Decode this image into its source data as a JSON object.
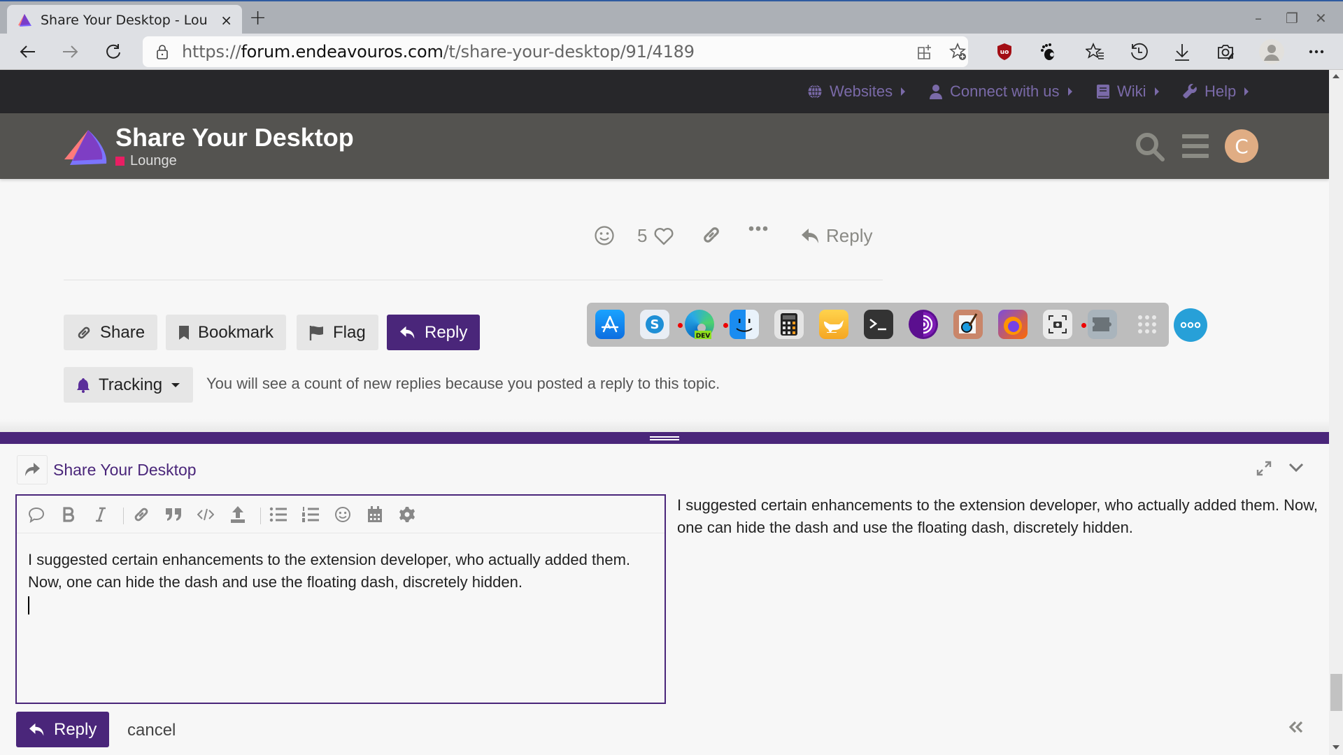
{
  "browser": {
    "tab_title": "Share Your Desktop - Lounge",
    "tab_close": "×",
    "new_tab": "+",
    "url_scheme": "https://",
    "url_host": "forum.endeavouros.com",
    "url_path": "/t/share-your-desktop/91/4189",
    "window_controls": {
      "minimize": "–",
      "restore": "❐",
      "close": "✕"
    },
    "toolbar_icons": [
      "split-screen-icon",
      "add-favorite-icon",
      "ublock-origin-icon",
      "gnome-extension-icon",
      "favorites-icon",
      "history-icon",
      "downloads-icon",
      "screenshot-icon",
      "profile-icon",
      "more-icon"
    ]
  },
  "topnav": {
    "items": [
      {
        "label": "Websites",
        "icon": "globe-icon"
      },
      {
        "label": "Connect with us",
        "icon": "user-icon"
      },
      {
        "label": "Wiki",
        "icon": "book-icon"
      },
      {
        "label": "Help",
        "icon": "wrench-icon"
      }
    ]
  },
  "header": {
    "title": "Share Your Desktop",
    "category": "Lounge",
    "category_color": "#e91e63",
    "avatar_letter": "C",
    "avatar_color": "#e0ad84"
  },
  "post_controls": {
    "like_count": "5",
    "reply_label": "Reply"
  },
  "topic_footer": {
    "share": "Share",
    "bookmark": "Bookmark",
    "flag": "Flag",
    "reply": "Reply",
    "tracking": "Tracking",
    "tracking_message": "You will see a count of new replies because you posted a reply to this topic."
  },
  "dock": {
    "apps": [
      "App Store",
      "Skype",
      "Edge Dev",
      "Finder",
      "Calculator",
      "Genie",
      "Terminal",
      "Tor Browser",
      "Paint",
      "Firefox",
      "Screenshot",
      "Extensions",
      "Show Applications"
    ],
    "dev_badge": "DEV"
  },
  "composer": {
    "reply_to_title": "Share Your Desktop",
    "editor_text": "I suggested certain enhancements to the extension developer, who actually added them. Now, one can hide the dash and use the floating dash, discretely hidden.",
    "preview_text": "I suggested certain enhancements to the extension developer, who actually added them. Now, one can hide the dash and use the floating dash, discretely hidden.",
    "submit_label": "Reply",
    "cancel_label": "cancel",
    "accent": "#4a267a"
  }
}
